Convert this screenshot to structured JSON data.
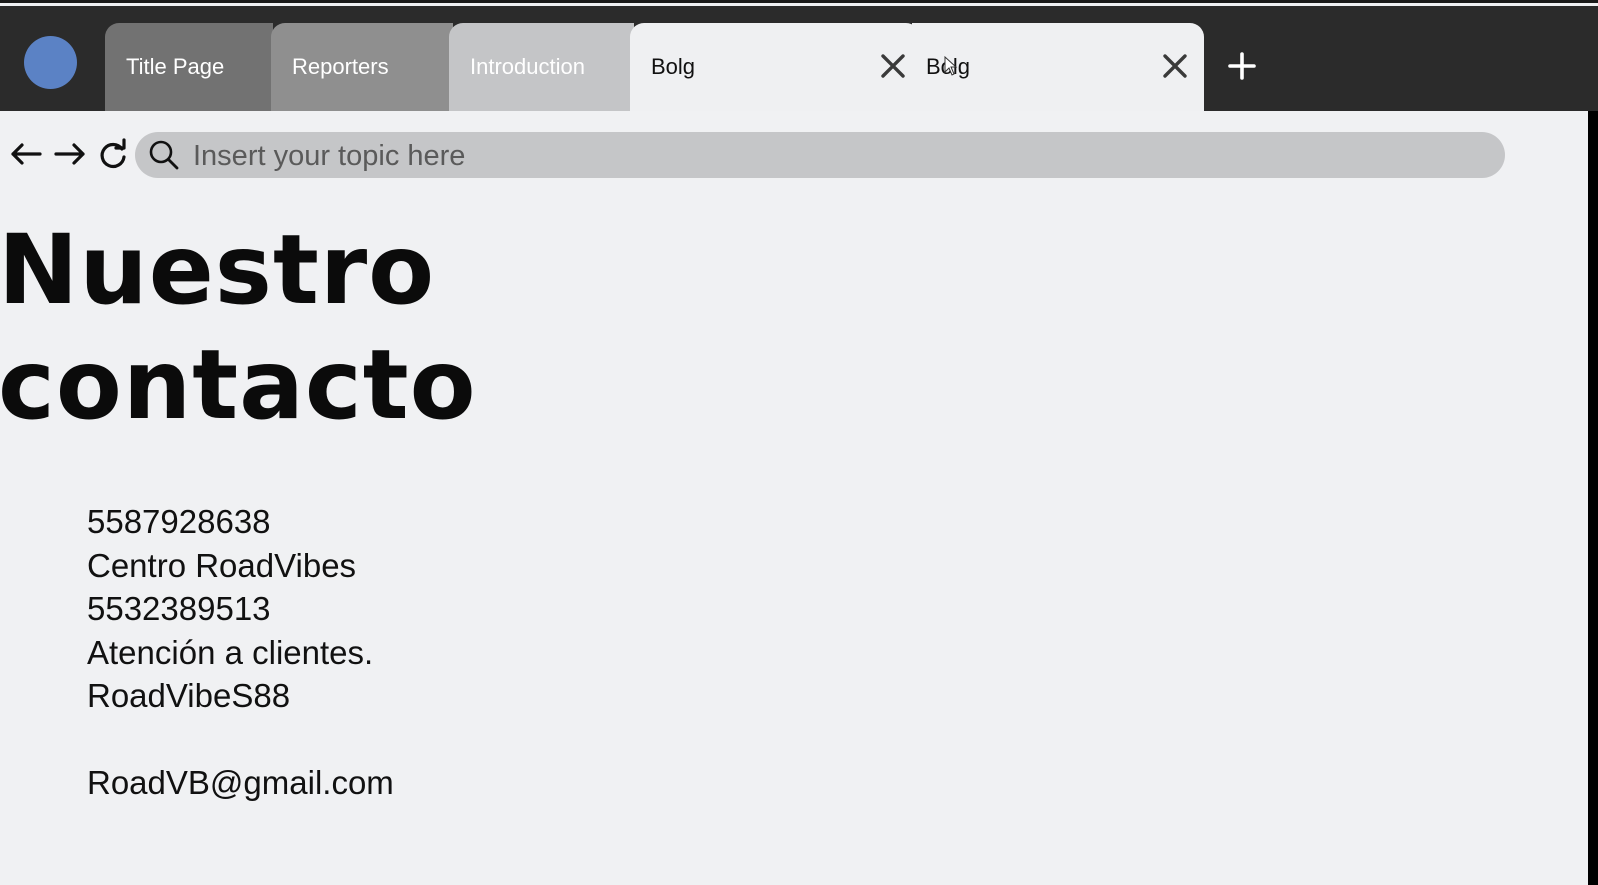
{
  "colors": {
    "tabbar_bg": "#2b2b2b",
    "avatar": "#5b82c5",
    "tab_1": "#727272",
    "tab_2": "#8f8f8f",
    "tab_3": "#c4c5c7",
    "tab_active": "#eff0f2",
    "search_bg": "#c5c6c8",
    "page_bg": "#f0f1f3"
  },
  "tabs": [
    {
      "label": "Title Page",
      "icon": null
    },
    {
      "label": "Reporters",
      "icon": null
    },
    {
      "label": "Introduction",
      "icon": null
    },
    {
      "label": "Bolg",
      "icon": "close-icon"
    },
    {
      "label": "Bolg",
      "icon": "close-icon"
    }
  ],
  "toolbar": {
    "new_tab_icon": "plus-icon",
    "back_icon": "arrow-left-icon",
    "forward_icon": "arrow-right-icon",
    "reload_icon": "reload-icon"
  },
  "search": {
    "placeholder": "Insert your topic here",
    "value": "",
    "icon": "search-icon"
  },
  "page": {
    "heading_line_1": "Nuestro",
    "heading_line_2": "contacto",
    "contact_lines": [
      "5587928638",
      "Centro RoadVibes",
      "5532389513",
      "Atención a clientes.",
      "RoadVibeS88",
      "",
      "RoadVB@gmail.com"
    ]
  }
}
